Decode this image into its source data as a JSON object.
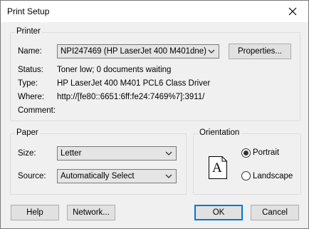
{
  "window": {
    "title": "Print Setup"
  },
  "printer": {
    "group_label": "Printer",
    "name_label": "Name:",
    "name_value": "NPI247469 (HP LaserJet 400 M401dne)",
    "properties_label": "Properties...",
    "status_label": "Status:",
    "status_value": "Toner low; 0 documents waiting",
    "type_label": "Type:",
    "type_value": "HP LaserJet 400 M401 PCL6 Class Driver",
    "where_label": "Where:",
    "where_value": "http://[fe80::6651:6ff:fe24:7469%7]:3911/",
    "comment_label": "Comment:",
    "comment_value": ""
  },
  "paper": {
    "group_label": "Paper",
    "size_label": "Size:",
    "size_value": "Letter",
    "source_label": "Source:",
    "source_value": "Automatically Select"
  },
  "orientation": {
    "group_label": "Orientation",
    "icon_letter": "A",
    "portrait_label": "Portrait",
    "landscape_label": "Landscape",
    "selected": "portrait"
  },
  "buttons": {
    "help": "Help",
    "network": "Network...",
    "ok": "OK",
    "cancel": "Cancel"
  },
  "icons": {
    "close": "close-icon",
    "dropdown": "chevron-down-icon"
  },
  "colors": {
    "default_button_border": "#0078d7",
    "dialog_bg": "#f0f0f0"
  }
}
